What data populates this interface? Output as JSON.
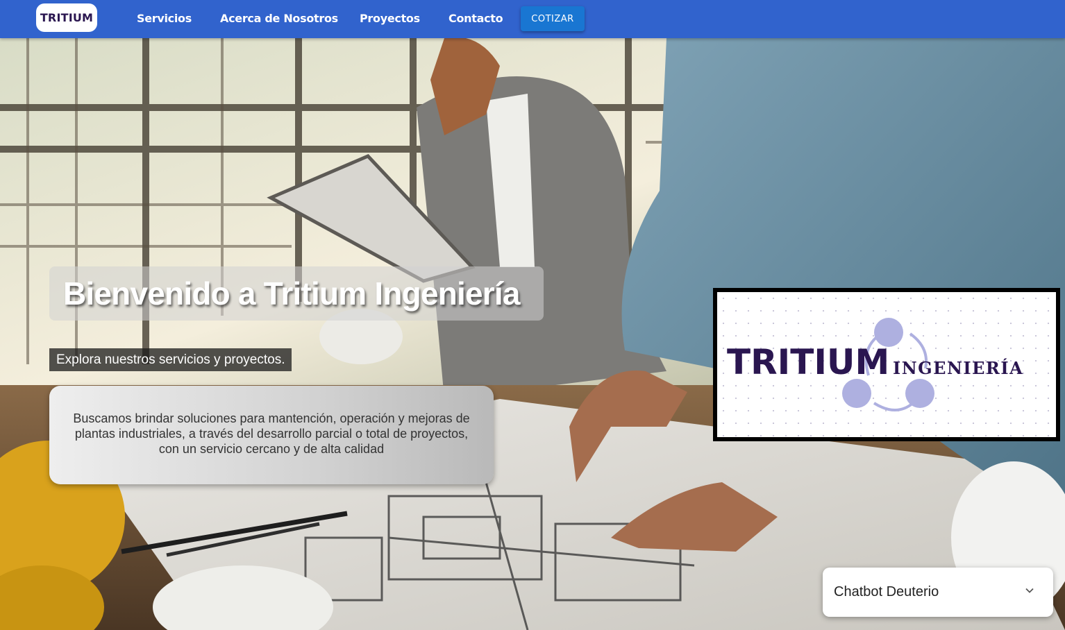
{
  "navbar": {
    "logo": "TRITIUM",
    "links": [
      "Servicios",
      "Acerca de Nosotros",
      "Proyectos",
      "Contacto"
    ],
    "cta": "COTIZAR",
    "background": "#3163cd",
    "cta_color": "#1976d2"
  },
  "hero": {
    "title": "Bienvenido a Tritium Ingeniería",
    "subtitle": "Explora nuestros servicios y proyectos.",
    "description": "Buscamos brindar soluciones para mantención, operación y mejoras de plantas industriales, a través del desarrollo parcial o total de proyectos, con un servicio cercano y de alta calidad",
    "background_image": "engineers-reviewing-blueprints"
  },
  "logo_panel": {
    "brand": "TRITIUM",
    "tagline": "INGENIERÍA",
    "brand_color": "#2a1650",
    "accent_color": "#aeb0e0"
  },
  "chatbot": {
    "title": "Chatbot Deuterio",
    "icon": "chevron-down-icon"
  }
}
